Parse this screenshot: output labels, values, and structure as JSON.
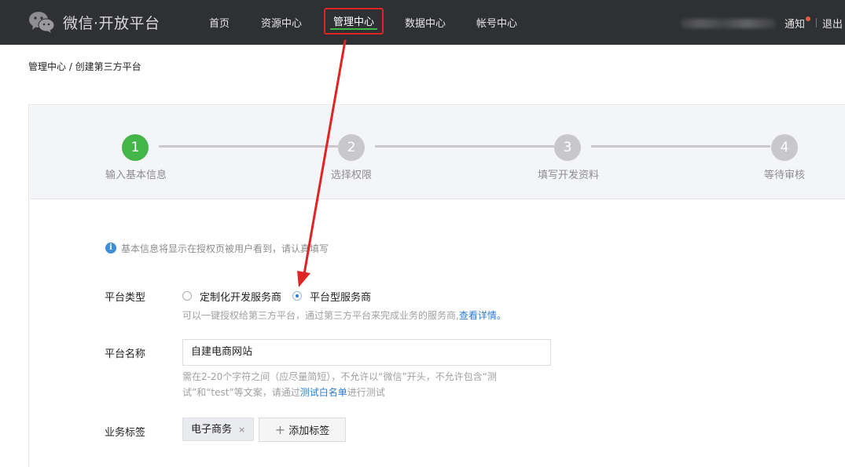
{
  "topbar": {
    "brand": "微信·开放平台",
    "nav": [
      "首页",
      "资源中心",
      "管理中心",
      "数据中心",
      "帐号中心"
    ],
    "notify": "通知",
    "logout": "退出"
  },
  "breadcrumb": "管理中心 / 创建第三方平台",
  "steps": [
    {
      "num": "1",
      "label": "输入基本信息"
    },
    {
      "num": "2",
      "label": "选择权限"
    },
    {
      "num": "3",
      "label": "填写开发资料"
    },
    {
      "num": "4",
      "label": "等待审核"
    }
  ],
  "notice": "基本信息将显示在授权页被用户看到，请认真填写",
  "form": {
    "type_label": "平台类型",
    "option_custom": "定制化开发服务商",
    "option_platform": "平台型服务商",
    "type_hint": "可以一键授权给第三方平台，通过第三方平台来完成业务的服务商,",
    "type_hint_link": "查看详情",
    "type_hint_end": "。",
    "name_label": "平台名称",
    "name_value": "自建电商网站",
    "name_hint_line1": "需在2-20个字符之间（应尽量简短），不允许以“微信”开头，不允许包含“测",
    "name_hint_line2_a": "试”和“test”等文案，请通过",
    "name_hint_link": "测试白名单",
    "name_hint_line2_b": "进行测试",
    "tags_label": "业务标签",
    "tag_value": "电子商务",
    "tag_close": "×",
    "add_tag_plus": "+",
    "add_tag": "添加标签"
  },
  "colors": {
    "topbar": "#2f3033",
    "active_step": "#44b549",
    "annotation": "#e02424",
    "link": "#2b7bd2"
  }
}
